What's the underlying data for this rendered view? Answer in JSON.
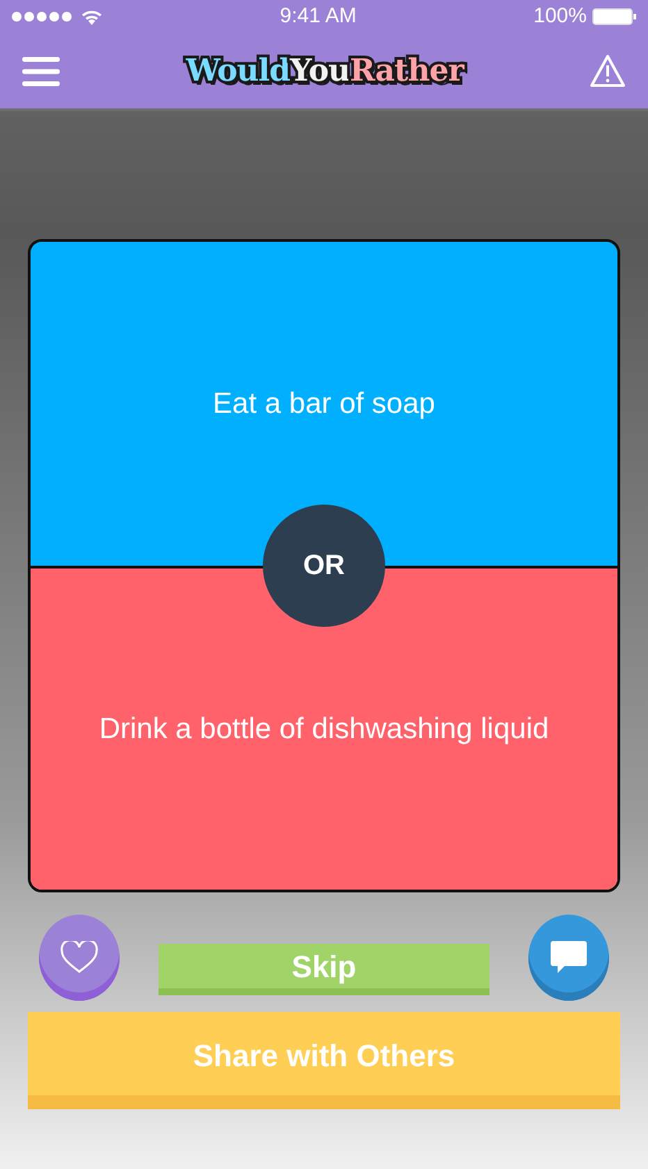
{
  "status_bar": {
    "time": "9:41 AM",
    "battery": "100%"
  },
  "header": {
    "logo": [
      {
        "text": "Would",
        "color": "#7adaff"
      },
      {
        "text": "You",
        "color": "#f2f2f2"
      },
      {
        "text": "Rather",
        "color": "#ffa3a9"
      }
    ]
  },
  "question": {
    "options": [
      {
        "text": "Eat a bar of soap",
        "color": "#00b0ff"
      },
      {
        "text": "Drink a bottle of dishwashing liquid",
        "color": "#ff626a"
      }
    ],
    "separator": "OR"
  },
  "actions": {
    "skip": "Skip",
    "share": "Share with Others"
  }
}
